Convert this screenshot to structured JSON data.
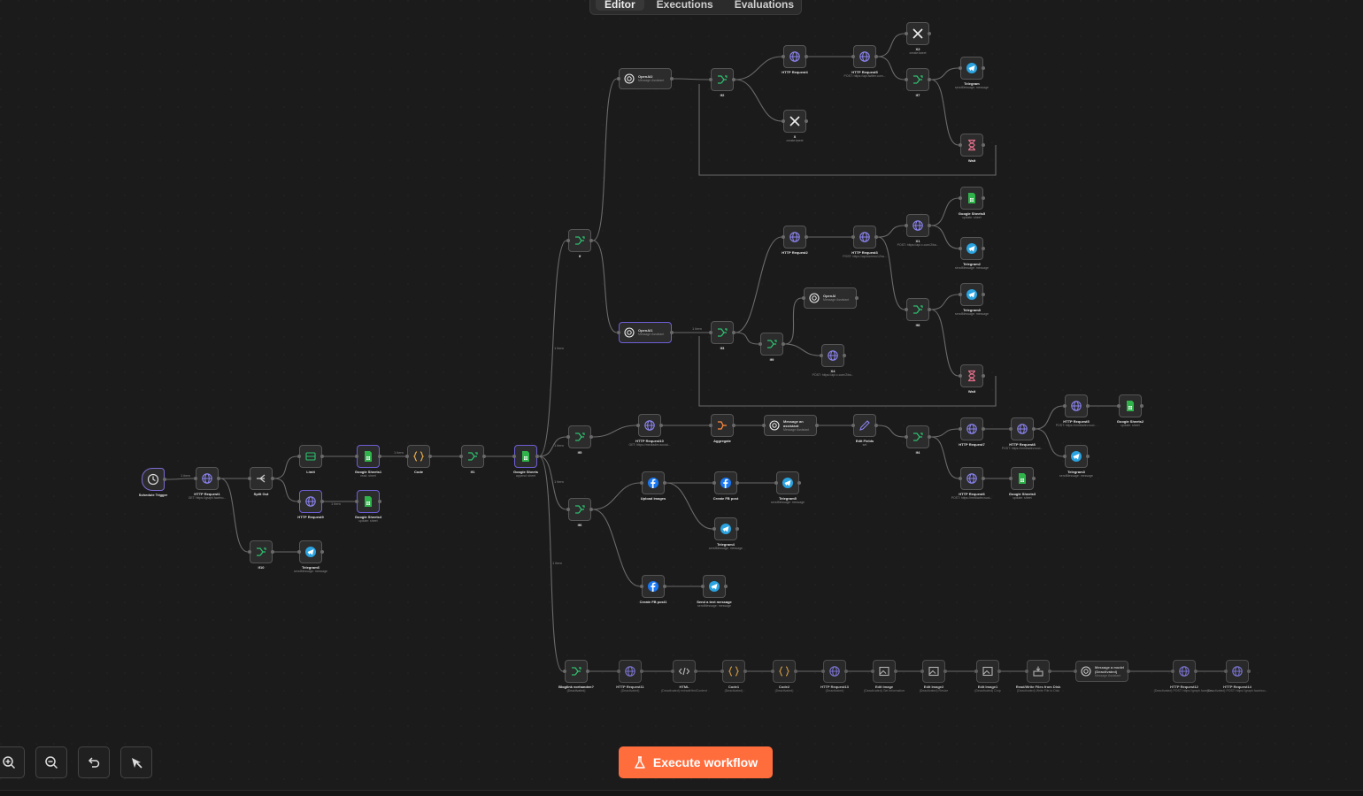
{
  "tabs": [
    {
      "label": "Editor",
      "active": true
    },
    {
      "label": "Executions",
      "active": false
    },
    {
      "label": "Evaluations",
      "active": false
    }
  ],
  "execute": {
    "label": "Execute workflow",
    "icon": "flask-icon"
  },
  "controls": [
    {
      "name": "zoom-in-button",
      "icon": "zoom-in-icon"
    },
    {
      "name": "zoom-out-button",
      "icon": "zoom-out-icon"
    },
    {
      "name": "undo-button",
      "icon": "undo-icon"
    },
    {
      "name": "tidy-up-button",
      "icon": "wand-icon"
    }
  ],
  "colors": {
    "background": "#1b1b1b",
    "accent": "#ff6d3d",
    "http": "#8b84f0",
    "branch": "#2dbf6e",
    "sheets": "#2fb34a",
    "telegram": "#2aa3e0",
    "facebook": "#1877f2",
    "aggregate": "#ff8a3d",
    "wait": "#e46f8a"
  },
  "nodes": [
    {
      "id": "schedule",
      "label": "Schedule Trigger",
      "sub": "",
      "icon": "clock-icon"
    },
    {
      "id": "http1",
      "label": "HTTP Request1",
      "sub": "GET: https://graph.facebo...",
      "icon": "globe-icon"
    },
    {
      "id": "splitout",
      "label": "Split Out",
      "sub": "",
      "icon": "split-icon"
    },
    {
      "id": "limit",
      "label": "Limit",
      "sub": "",
      "icon": "limit-icon"
    },
    {
      "id": "httpreq9",
      "label": "HTTP Request9",
      "sub": "",
      "icon": "globe-icon"
    },
    {
      "id": "if10",
      "label": "If10",
      "sub": "",
      "icon": "branch-icon"
    },
    {
      "id": "gs1",
      "label": "Google Sheets1",
      "sub": "read: sheet",
      "icon": "sheets-icon"
    },
    {
      "id": "gs4",
      "label": "Google Sheets4",
      "sub": "update: sheet",
      "icon": "sheets-icon"
    },
    {
      "id": "tg6",
      "label": "Telegram6",
      "sub": "sendMessage: message",
      "icon": "telegram-icon"
    },
    {
      "id": "code",
      "label": "Code",
      "sub": "",
      "icon": "braces-icon"
    },
    {
      "id": "if1",
      "label": "If1",
      "sub": "",
      "icon": "branch-icon"
    },
    {
      "id": "gs",
      "label": "Google Sheets",
      "sub": "append: sheet",
      "icon": "sheets-icon"
    },
    {
      "id": "if3",
      "label": "If",
      "sub": "",
      "icon": "branch-icon"
    },
    {
      "id": "if5",
      "label": "If5",
      "sub": "",
      "icon": "branch-icon"
    },
    {
      "id": "if6",
      "label": "If6",
      "sub": "",
      "icon": "branch-icon"
    },
    {
      "id": "bloglink",
      "label": "Bloglink vorhanden?",
      "sub": "(Deactivated)",
      "icon": "branch-icon"
    },
    {
      "id": "openai2",
      "label": "OpenAI2",
      "sub": "Message Assistant",
      "icon": "openai-icon",
      "wide": true
    },
    {
      "id": "openai1",
      "label": "OpenAI1",
      "sub": "Message Assistant",
      "icon": "openai-icon",
      "wide": true
    },
    {
      "id": "if2",
      "label": "If2",
      "sub": "",
      "icon": "branch-icon"
    },
    {
      "id": "if3b",
      "label": "If3",
      "sub": "",
      "icon": "branch-icon"
    },
    {
      "id": "httpreq4",
      "label": "HTTP Request4",
      "sub": "",
      "icon": "globe-icon"
    },
    {
      "id": "httpreq5",
      "label": "HTTP Request5",
      "sub": "POST: https://api.twitter.com...",
      "icon": "globe-icon"
    },
    {
      "id": "x2",
      "label": "X2",
      "sub": "create:tweet",
      "icon": "x-icon"
    },
    {
      "id": "if7",
      "label": "If7",
      "sub": "",
      "icon": "branch-icon"
    },
    {
      "id": "x",
      "label": "X",
      "sub": "create:tweet",
      "icon": "x-icon"
    },
    {
      "id": "telegram",
      "label": "Telegram",
      "sub": "sendMessage: message",
      "icon": "telegram-icon"
    },
    {
      "id": "wait",
      "label": "Wait",
      "sub": "",
      "icon": "hourglass-icon"
    },
    {
      "id": "httpreq2",
      "label": "HTTP Request2",
      "sub": "",
      "icon": "globe-icon"
    },
    {
      "id": "httpreq3",
      "label": "HTTP Request3",
      "sub": "POST: https://api.kommo12ha...",
      "icon": "globe-icon"
    },
    {
      "id": "x1",
      "label": "X1",
      "sub": "POST: https://api.x.com/2/tw...",
      "icon": "globe-icon"
    },
    {
      "id": "gs5",
      "label": "Google Sheets5",
      "sub": "update: sheet",
      "icon": "sheets-icon"
    },
    {
      "id": "tg2",
      "label": "Telegram2",
      "sub": "sendMessage: message",
      "icon": "telegram-icon"
    },
    {
      "id": "if8",
      "label": "If8",
      "sub": "",
      "icon": "branch-icon"
    },
    {
      "id": "tg8",
      "label": "Telegram8",
      "sub": "sendMessage: message",
      "icon": "telegram-icon"
    },
    {
      "id": "wait1",
      "label": "Wait",
      "sub": "",
      "icon": "hourglass-icon"
    },
    {
      "id": "openai",
      "label": "OpenAI",
      "sub": "Message Assistant",
      "icon": "openai-icon",
      "wide": true
    },
    {
      "id": "if9",
      "label": "If9",
      "sub": "",
      "icon": "branch-icon"
    },
    {
      "id": "x4",
      "label": "X4",
      "sub": "POST: https://api.x.com/2/tw...",
      "icon": "globe-icon"
    },
    {
      "id": "httpreq10",
      "label": "HTTP Request10",
      "sub": "GET: https://mediadev.social...",
      "icon": "globe-icon"
    },
    {
      "id": "aggregate",
      "label": "Aggregate",
      "sub": "",
      "icon": "aggregate-icon"
    },
    {
      "id": "msgassist",
      "label": "Message an assistant",
      "sub": "Message Assistant",
      "icon": "openai-icon",
      "wide": true
    },
    {
      "id": "editfields",
      "label": "Edit Fields",
      "sub": "set",
      "icon": "pencil-icon"
    },
    {
      "id": "if4",
      "label": "If4",
      "sub": "",
      "icon": "branch-icon"
    },
    {
      "id": "httpreq7",
      "label": "HTTP Request7",
      "sub": "",
      "icon": "globe-icon"
    },
    {
      "id": "httpreq8",
      "label": "HTTP Request8",
      "sub": "POST: https://mediadev.soci...",
      "icon": "globe-icon"
    },
    {
      "id": "httpreq6",
      "label": "HTTP Request6",
      "sub": "POST: https://mediadev.soci...",
      "icon": "globe-icon"
    },
    {
      "id": "gs3",
      "label": "Google Sheets3",
      "sub": "update: sheet",
      "icon": "sheets-icon"
    },
    {
      "id": "tg3",
      "label": "Telegram3",
      "sub": "sendMessage: message",
      "icon": "telegram-icon"
    },
    {
      "id": "httpreq5b",
      "label": "HTTP Request5",
      "sub": "POST: https://mediadev.soci...",
      "icon": "globe-icon"
    },
    {
      "id": "gs2",
      "label": "Google Sheets2",
      "sub": "update: sheet",
      "icon": "sheets-icon"
    },
    {
      "id": "upload",
      "label": "Upload images",
      "sub": "",
      "icon": "facebook-icon"
    },
    {
      "id": "createfb",
      "label": "Create FB post",
      "sub": "",
      "icon": "facebook-icon"
    },
    {
      "id": "tg5",
      "label": "Telegram5",
      "sub": "sendMessage: message",
      "icon": "telegram-icon"
    },
    {
      "id": "tg4",
      "label": "Telegram4",
      "sub": "sendMessage: message",
      "icon": "telegram-icon"
    },
    {
      "id": "createfb1",
      "label": "Create FB post1",
      "sub": "",
      "icon": "facebook-icon"
    },
    {
      "id": "sendtext",
      "label": "Send a text message",
      "sub": "sendMessage: message",
      "icon": "telegram-icon"
    },
    {
      "id": "httpreq11",
      "label": "HTTP Request11",
      "sub": "(Deactivated)",
      "icon": "globe-icon",
      "dis": true
    },
    {
      "id": "html",
      "label": "HTML",
      "sub": "(Deactivated) extractHtmlContent",
      "icon": "code-icon",
      "dis": true
    },
    {
      "id": "code1",
      "label": "Code1",
      "sub": "(Deactivated)",
      "icon": "braces-icon",
      "dis": true
    },
    {
      "id": "code2",
      "label": "Code2",
      "sub": "(Deactivated)",
      "icon": "braces-icon",
      "dis": true
    },
    {
      "id": "httpreq13",
      "label": "HTTP Request13",
      "sub": "(Deactivated)",
      "icon": "globe-icon",
      "dis": true
    },
    {
      "id": "editimage",
      "label": "Edit Image",
      "sub": "(Deactivated) Get Information",
      "icon": "image-icon",
      "dis": true
    },
    {
      "id": "editimage2",
      "label": "Edit Image2",
      "sub": "(Deactivated) Resize",
      "icon": "image-icon",
      "dis": true
    },
    {
      "id": "editimage1",
      "label": "Edit Image1",
      "sub": "(Deactivated) Crop",
      "icon": "image-icon",
      "dis": true
    },
    {
      "id": "rwfiles",
      "label": "Read/Write Files from Disk",
      "sub": "(Deactivated) Write File to Disk",
      "icon": "disk-icon",
      "dis": true
    },
    {
      "id": "msgmodel",
      "label": "Message a model (Deactivated)",
      "sub": "Message Assistant",
      "icon": "openai-icon",
      "wide": true,
      "dis": true
    },
    {
      "id": "httpreq12",
      "label": "HTTP Request12",
      "sub": "(Deactivated) POST: https://graph.faceboo...",
      "icon": "globe-icon",
      "dis": true
    },
    {
      "id": "httpreq14",
      "label": "HTTP Request14",
      "sub": "(Deactivated) POST: https://graph.faceboo...",
      "icon": "globe-icon",
      "dis": true
    }
  ],
  "edge_labels": [
    "1 item",
    "1 item",
    "1 item",
    "1 item",
    "1 item",
    "1 item",
    "1 item",
    "1 item"
  ]
}
